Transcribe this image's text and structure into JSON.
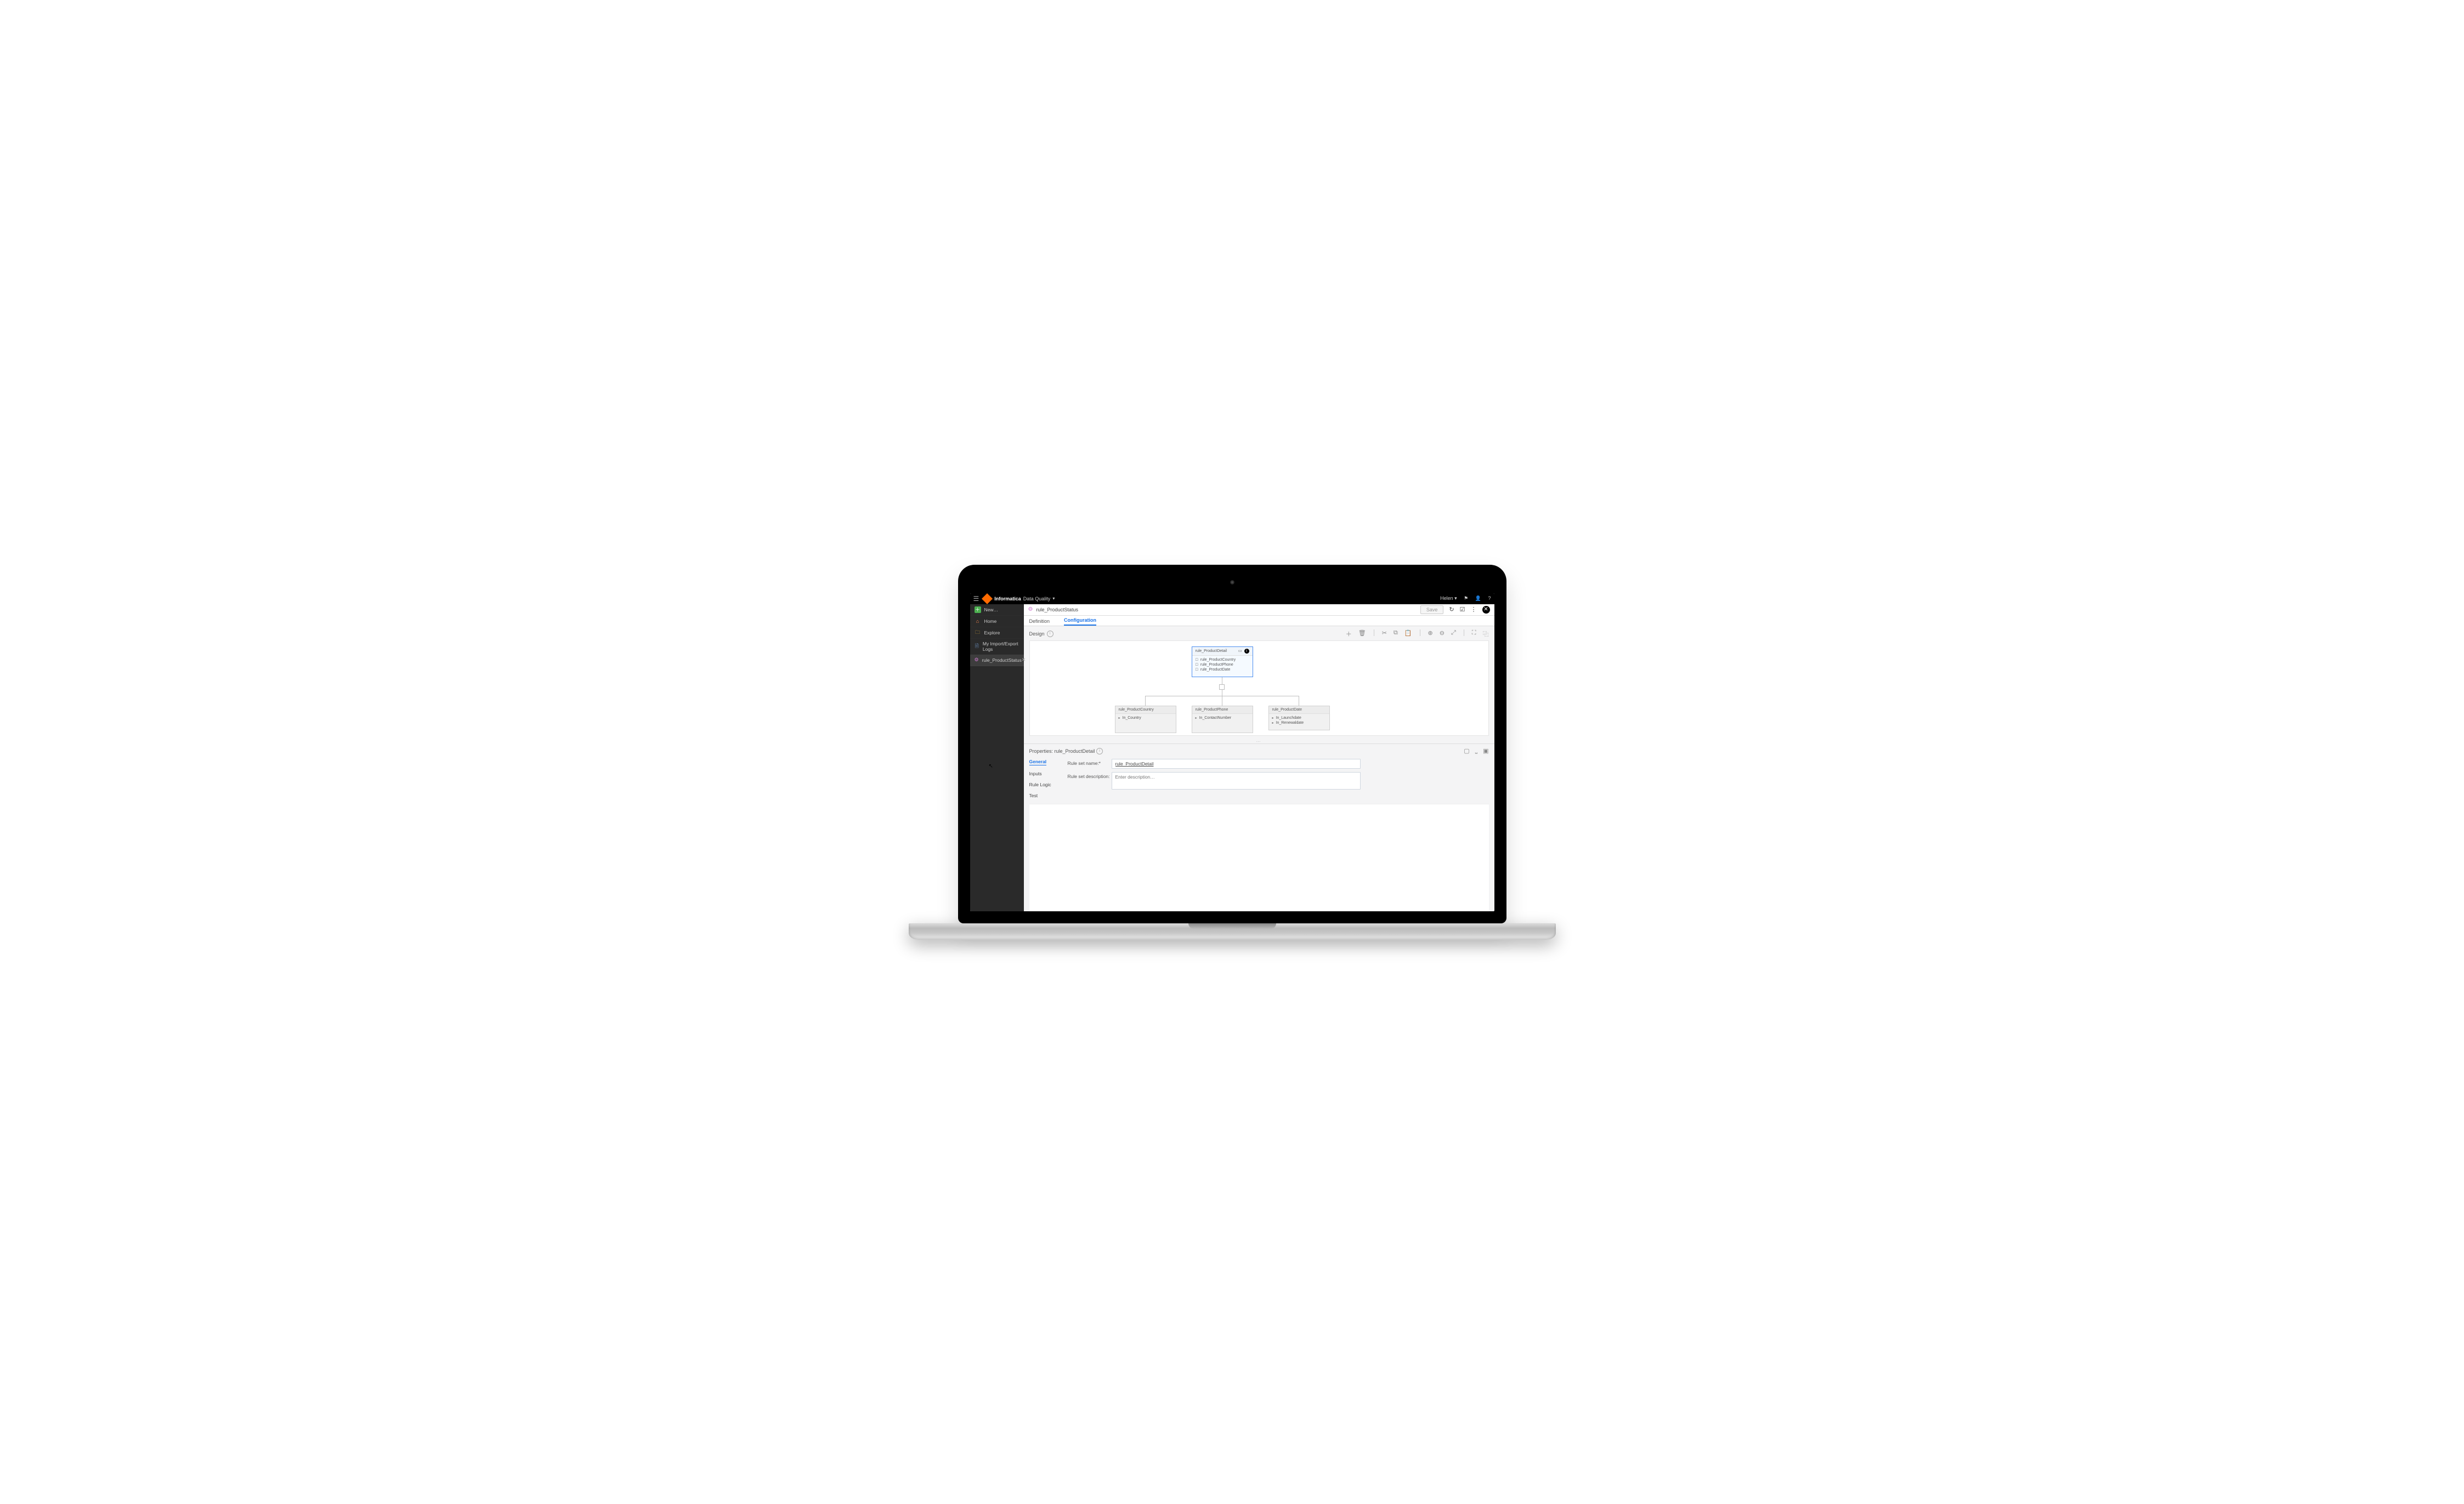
{
  "brand": "Informatica",
  "product": "Data Quality",
  "user": "Helen",
  "sidebar": {
    "items": [
      {
        "label": "New…",
        "icon": "＋",
        "col": "#4caf50"
      },
      {
        "label": "Home",
        "icon": "⌂",
        "col": "#ff7043"
      },
      {
        "label": "Explore",
        "icon": "📁",
        "col": "#d4a53b"
      },
      {
        "label": "My Import/Export Logs",
        "icon": "📄",
        "col": "#5a8bd6"
      },
      {
        "label": "rule_ProductStatus",
        "icon": "⚙",
        "col": "#d07bd0",
        "active": true,
        "closable": true
      }
    ]
  },
  "page": {
    "icon": "⚙",
    "title": "rule_ProductStatus",
    "save_label": "Save"
  },
  "tabs": {
    "definition": "Definition",
    "configuration": "Configuration"
  },
  "design": {
    "label": "Design"
  },
  "nodes": {
    "root": {
      "title": "rule_ProductDetail",
      "rows": [
        "rule_ProductCountry",
        "rule_ProductPhone",
        "rule_ProductDate"
      ]
    },
    "c1": {
      "title": "rule_ProductCountry",
      "rows": [
        "In_Country"
      ]
    },
    "c2": {
      "title": "rule_ProductPhone",
      "rows": [
        "In_ContactNumber"
      ]
    },
    "c3": {
      "title": "rule_ProductDate",
      "rows": [
        "In_Launchdate",
        "In_Renewaldate"
      ]
    }
  },
  "properties": {
    "heading": "Properties: rule_ProductDetail",
    "nav": {
      "general": "General",
      "inputs": "Inputs",
      "logic": "Rule Logic",
      "test": "Test"
    },
    "name_label": "Rule set name:*",
    "name_value": "rule_ProductDetail",
    "desc_label": "Rule set description:",
    "desc_placeholder": "Enter description…"
  }
}
